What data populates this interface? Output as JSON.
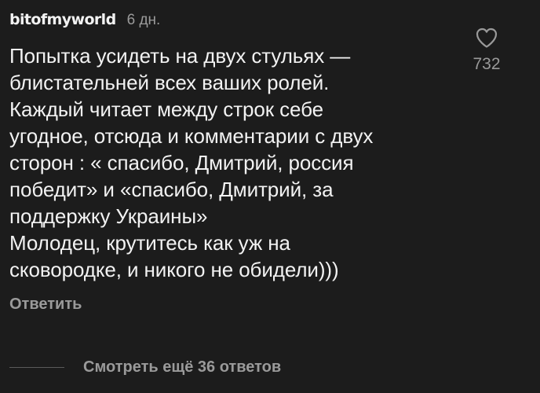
{
  "comment": {
    "username": "bitofmyworld",
    "time": "6 дн.",
    "text": "Попытка усидеть на двух стульях —\nблистательней всех ваших ролей.\nКаждый читает между строк себе\nугодное, отсюда и комментарии с двух\nсторон : « спасибо, Дмитрий, россия\nпобедит» и «спасибо, Дмитрий, за\nподдержку Украины»\nМолодец, крутитесь как уж на\nсковородке, и никого не обидели)))",
    "reply_label": "Ответить",
    "like_icon": "heart-outline",
    "like_count": "732"
  },
  "replies": {
    "view_more_label": "Смотреть ещё 36 ответов"
  },
  "colors": {
    "background": "#1c1c1c",
    "text_primary": "#f2f2f2",
    "text_secondary": "#9a9a9a"
  }
}
